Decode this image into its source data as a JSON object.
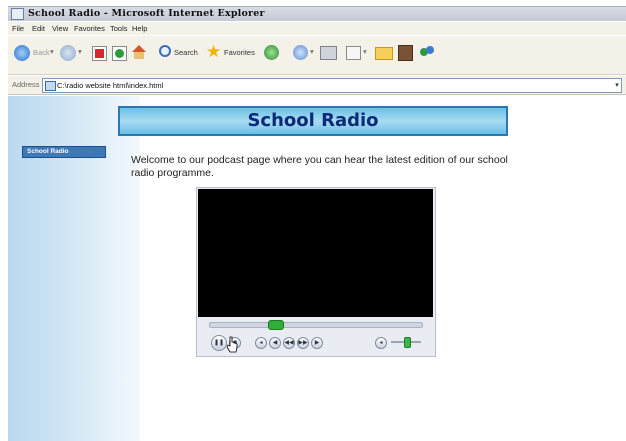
{
  "window": {
    "title": "School Radio - Microsoft Internet Explorer"
  },
  "menu": [
    "File",
    "Edit",
    "View",
    "Favorites",
    "Tools",
    "Help"
  ],
  "toolbar": {
    "back_label": "Back",
    "search_label": "Search",
    "favorites_label": "Favorites"
  },
  "address": {
    "label": "Address",
    "url": "C:\\radio website html\\index.html"
  },
  "sidebar": {
    "nav_label": "School Radio"
  },
  "page": {
    "banner_title": "School Radio",
    "intro": "Welcome to our podcast page where you can hear the latest edition of our school radio programme."
  },
  "player": {
    "seek_position": 0.3,
    "volume_level": 0.5,
    "state": "playing"
  },
  "colors": {
    "banner": "#6cc0e6",
    "banner_text": "#0b2a7a",
    "sidebar": "#b9d8ef",
    "nav_button": "#3f78b8"
  }
}
